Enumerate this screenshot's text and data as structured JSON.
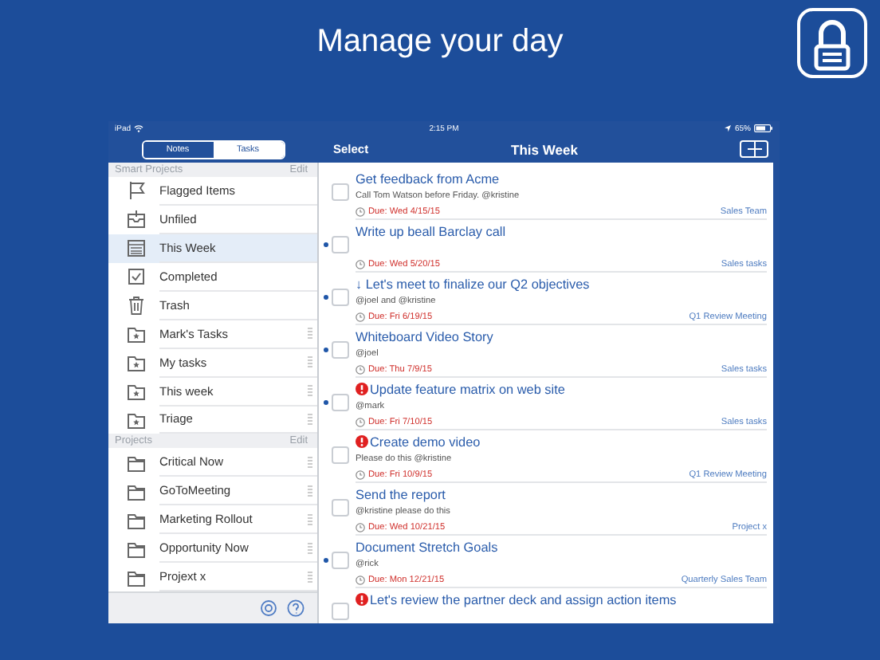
{
  "headline": "Manage your day",
  "status_bar": {
    "device": "iPad",
    "time": "2:15 PM",
    "battery": "65%"
  },
  "segments": [
    {
      "label": "Notes",
      "selected": false
    },
    {
      "label": "Tasks",
      "selected": true
    }
  ],
  "nav": {
    "left": "Select",
    "title": "This Week"
  },
  "sidebar": {
    "sections": [
      {
        "title": "Smart Projects",
        "action": "Edit",
        "items": [
          {
            "label": "Flagged Items",
            "kind": "flag",
            "selected": false
          },
          {
            "label": "Unfiled",
            "kind": "inbox",
            "selected": false
          },
          {
            "label": "This Week",
            "kind": "calendar",
            "selected": true
          },
          {
            "label": "Completed",
            "kind": "check",
            "selected": false
          },
          {
            "label": "Trash",
            "kind": "trash",
            "selected": false
          },
          {
            "label": "Mark's Tasks",
            "kind": "smart-folder",
            "selected": false
          },
          {
            "label": "My tasks",
            "kind": "smart-folder",
            "selected": false
          },
          {
            "label": "This week",
            "kind": "smart-folder",
            "selected": false
          },
          {
            "label": "Triage",
            "kind": "smart-folder",
            "selected": false
          }
        ]
      },
      {
        "title": "Projects",
        "action": "Edit",
        "items": [
          {
            "label": "Critical Now",
            "kind": "folder",
            "selected": false
          },
          {
            "label": "GoToMeeting",
            "kind": "folder",
            "selected": false
          },
          {
            "label": "Marketing Rollout",
            "kind": "folder",
            "selected": false
          },
          {
            "label": "Opportunity Now",
            "kind": "folder",
            "selected": false
          },
          {
            "label": "Projext x",
            "kind": "folder",
            "selected": false
          }
        ]
      }
    ]
  },
  "tasks": [
    {
      "title": "Get feedback from Acme",
      "note": "Call Tom Watson before Friday. @kristine",
      "due": "Due: Wed 4/15/15",
      "project": "Sales Team",
      "unread": false,
      "priority": false,
      "checked": false
    },
    {
      "title": "Write up beall Barclay call",
      "due": "Due: Wed 5/20/15",
      "project": "Sales tasks",
      "unread": true,
      "priority": false,
      "checked": false
    },
    {
      "title": "↓ Let's meet to finalize our Q2 objectives",
      "note": "@joel and @kristine",
      "due": "Due: Fri 6/19/15",
      "project": "Q1 Review Meeting",
      "unread": true,
      "priority": false,
      "checked": false
    },
    {
      "title": "Whiteboard Video Story",
      "note": "@joel",
      "due": "Due: Thu 7/9/15",
      "project": "Sales tasks",
      "unread": true,
      "priority": false,
      "checked": false
    },
    {
      "title": "Update feature matrix on web site",
      "note": "@mark",
      "due": "Due: Fri 7/10/15",
      "project": "Sales tasks",
      "unread": true,
      "priority": true,
      "checked": false
    },
    {
      "title": "Create demo video",
      "note": "Please do this @kristine",
      "due": "Due: Fri 10/9/15",
      "project": "Q1 Review Meeting",
      "unread": false,
      "priority": true,
      "checked": false
    },
    {
      "title": "Send the report",
      "note": "@kristine please do this",
      "due": "Due: Wed 10/21/15",
      "project": "Project x",
      "unread": false,
      "priority": false,
      "checked": false
    },
    {
      "title": "Document Stretch Goals",
      "note": "@rick",
      "due": "Due: Mon 12/21/15",
      "project": "Quarterly Sales Team",
      "unread": true,
      "priority": false,
      "checked": false
    },
    {
      "title": "Let's review the partner deck and assign action items",
      "unread": false,
      "priority": true,
      "checked": false
    }
  ]
}
